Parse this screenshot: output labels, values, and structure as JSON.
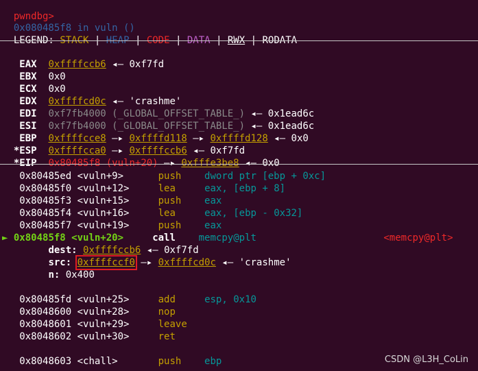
{
  "header": {
    "prompt": "pwndbg>",
    "location": "0x080485f8 in vuln ()"
  },
  "legend": {
    "label": "LEGEND:",
    "stack": "STACK",
    "heap": "HEAP",
    "code": "CODE",
    "data": "DATA",
    "rwx": "RWX",
    "rodata": "RODATA",
    "sep": "|"
  },
  "registers": [
    {
      "name": "EAX",
      "marker": " ",
      "value": "0xffffccb6",
      "arrow": "◂—",
      "chain": "0xf7fd"
    },
    {
      "name": "EBX",
      "marker": " ",
      "value": "0x0"
    },
    {
      "name": "ECX",
      "marker": " ",
      "value": "0x0"
    },
    {
      "name": "EDX",
      "marker": " ",
      "value": "0xffffcd0c",
      "arrow": "◂—",
      "chain": "'crashme'"
    },
    {
      "name": "EDI",
      "marker": " ",
      "value": "0xf7fb4000 (_GLOBAL_OFFSET_TABLE_)",
      "arrow": "◂—",
      "chain": "0x1ead6c"
    },
    {
      "name": "ESI",
      "marker": " ",
      "value": "0xf7fb4000 (_GLOBAL_OFFSET_TABLE_)",
      "arrow": "◂—",
      "chain": "0x1ead6c"
    },
    {
      "name": "EBP",
      "marker": " ",
      "value": "0xffffcce8",
      "chain1": "0xffffd118",
      "chain2": "0xffffd128",
      "arrow": "◂—",
      "chain": "0x0"
    },
    {
      "name": "ESP",
      "marker": "*",
      "value": "0xffffcca0",
      "chain1": "0xffffccb6",
      "arrow": "◂—",
      "chain": "0xf7fd"
    },
    {
      "name": "EIP",
      "marker": "*",
      "value": "0x80485f8 (vuln+20)",
      "chain1": "0xfffe3be8",
      "arrow": "◂—",
      "chain": "0x0"
    }
  ],
  "disasm": [
    {
      "addr": "0x80485ed <vuln+9>",
      "mnemonic": "push",
      "operand": "dword ptr [ebp + 0xc]"
    },
    {
      "addr": "0x80485f0 <vuln+12>",
      "mnemonic": "lea",
      "operand": "eax, [ebp + 8]"
    },
    {
      "addr": "0x80485f3 <vuln+15>",
      "mnemonic": "push",
      "operand": "eax"
    },
    {
      "addr": "0x80485f4 <vuln+16>",
      "mnemonic": "lea",
      "operand": "eax, [ebp - 0x32]"
    },
    {
      "addr": "0x80485f7 <vuln+19>",
      "mnemonic": "push",
      "operand": "eax"
    }
  ],
  "current": {
    "pointer": "►",
    "addr": "0x80485f8 <vuln+20>",
    "mnemonic": "call",
    "operand": "memcpy@plt",
    "target": "<memcpy@plt>"
  },
  "args": {
    "dest_label": "dest:",
    "dest_value": "0xffffccb6",
    "dest_arrow": "◂—",
    "dest_chain": "0xf7fd",
    "src_label": "src:",
    "src_value": "0xffffccf0",
    "src_chain1": "0xffffcd0c",
    "src_arrow": "◂—",
    "src_chain": "'crashme'",
    "n_label": "n:",
    "n_value": "0x400"
  },
  "disasm2": [
    {
      "addr": "0x80485fd <vuln+25>",
      "mnemonic": "add",
      "operand": "esp, 0x10"
    },
    {
      "addr": "0x8048600 <vuln+28>",
      "mnemonic": "nop",
      "operand": ""
    },
    {
      "addr": "0x8048601 <vuln+29>",
      "mnemonic": "leave",
      "operand": ""
    },
    {
      "addr": "0x8048602 <vuln+30>",
      "mnemonic": "ret",
      "operand": ""
    }
  ],
  "disasm3": {
    "addr": "0x8048603 <chall>",
    "mnemonic": "push",
    "operand": "ebp"
  },
  "watermark": "CSDN @L3H_CoLin"
}
